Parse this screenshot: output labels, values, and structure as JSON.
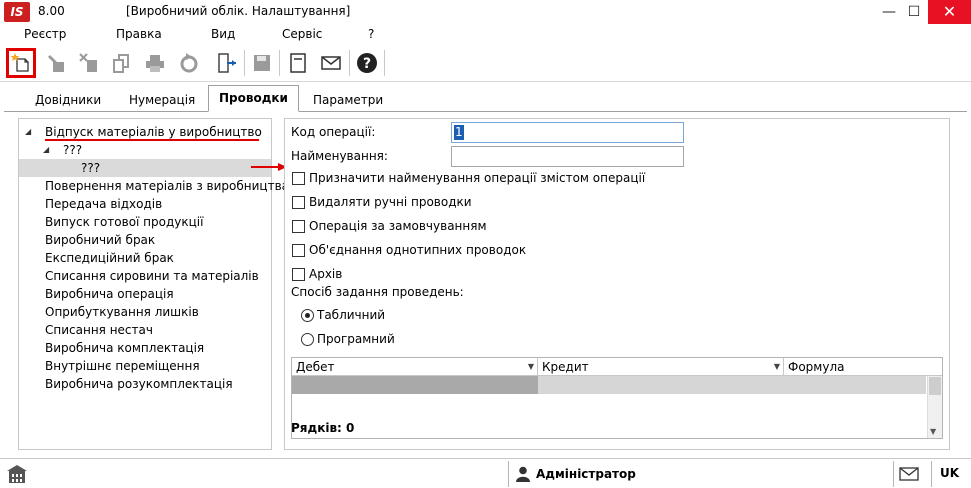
{
  "window": {
    "logo": "IS",
    "version": "8.00",
    "title": "[Виробничий облік. Налаштування]",
    "controls": {
      "minimize": "—",
      "maximize": "☐",
      "close": "✕"
    }
  },
  "menu": [
    "Реєстр",
    "Правка",
    "Вид",
    "Сервіс",
    "?"
  ],
  "toolbar": {
    "icons": [
      "new-document-icon",
      "edit-icon",
      "delete-icon",
      "copy-icon",
      "print-icon",
      "refresh-icon",
      "exit-icon",
      "save-icon",
      "document-icon",
      "mail-icon",
      "help-icon"
    ]
  },
  "tabs": [
    {
      "label": "Довідники",
      "active": false
    },
    {
      "label": "Нумерація",
      "active": false
    },
    {
      "label": "Проводки",
      "active": true
    },
    {
      "label": "Параметри",
      "active": false
    }
  ],
  "tree": {
    "root": "Відпуск матеріалів у виробництво",
    "child": "???",
    "grandchild": "???",
    "items": [
      "Повернення матеріалів з виробництва",
      "Передача відходів",
      "Випуск готової продукції",
      "Виробничий брак",
      "Експедиційний брак",
      "Списання сировини та матеріалів",
      "Виробнича операція",
      "Оприбуткування лишків",
      "Списання нестач",
      "Виробнича комплектація",
      "Внутрішнє переміщення",
      "Виробнича розукомплектація"
    ]
  },
  "form": {
    "code_label": "Код операції:",
    "code_value": "1",
    "name_label": "Найменування:",
    "name_value": "",
    "checkboxes": [
      "Призначити найменування операції змістом операції",
      "Видаляти ручні проводки",
      "Операція за замовчуванням",
      "Об'єднання однотипних проводок",
      "Архів"
    ],
    "method_label": "Спосіб задання проведень:",
    "radios": [
      {
        "label": "Табличний",
        "checked": true
      },
      {
        "label": "Програмний",
        "checked": false
      }
    ],
    "grid": {
      "columns": [
        "Дебет",
        "Кредит",
        "Формула"
      ],
      "rows_label": "Рядків: 0"
    }
  },
  "status": {
    "user": "Адміністратор",
    "lang": "UK"
  },
  "colors": {
    "close_button": "#e81123",
    "highlight": "#e00000",
    "logo": "#cc1f1f"
  }
}
